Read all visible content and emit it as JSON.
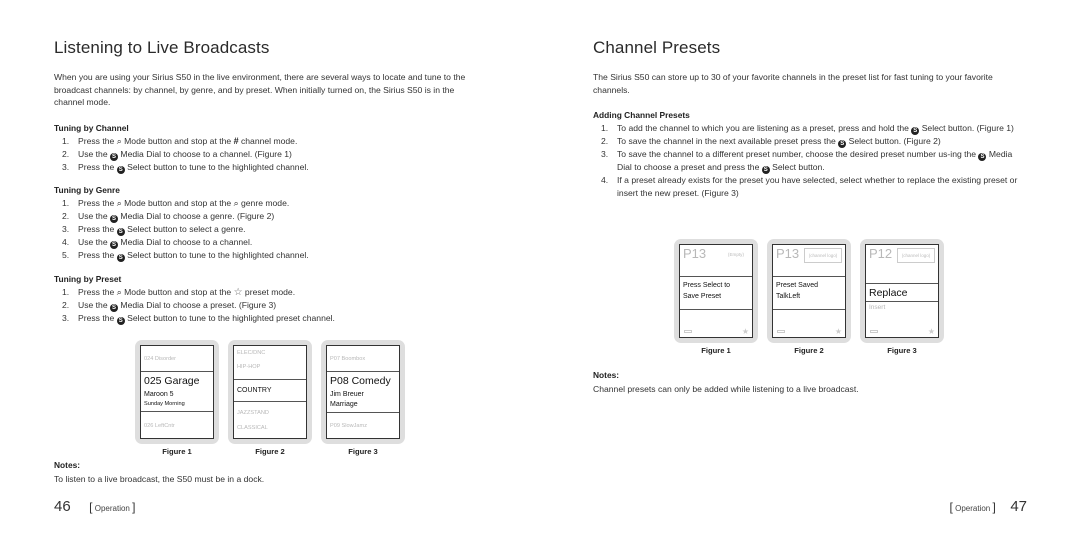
{
  "left_page": {
    "title": "Listening to Live Broadcasts",
    "intro": "When you are using your Sirius S50 in the live environment, there are several ways to locate and tune to the broadcast channels: by channel, by genre, and by preset. When initially turned on, the Sirius S50 is in the channel mode.",
    "sections": [
      {
        "heading": "Tuning by Channel",
        "steps": [
          {
            "num": "1.",
            "pre": "Press the",
            "icon1": "search-icon",
            "mid": "Mode button and stop at the",
            "icon2": "hash-icon",
            "post": "channel mode."
          },
          {
            "num": "2.",
            "pre": "Use the",
            "icon1": "media-dial-icon",
            "post": "Media Dial to choose to a channel. (Figure 1)"
          },
          {
            "num": "3.",
            "pre": "Press the",
            "icon1": "select-button-icon",
            "post": "Select button to tune to the highlighted channel."
          }
        ]
      },
      {
        "heading": "Tuning by Genre",
        "steps": [
          {
            "num": "1.",
            "pre": "Press the",
            "icon1": "search-icon",
            "mid": "Mode button and stop at the",
            "icon2": "search-icon",
            "post": "genre mode."
          },
          {
            "num": "2.",
            "pre": "Use the",
            "icon1": "media-dial-icon",
            "post": "Media Dial to choose a genre. (Figure 2)"
          },
          {
            "num": "3.",
            "pre": "Press the",
            "icon1": "select-button-icon",
            "post": "Select button to select a genre."
          },
          {
            "num": "4.",
            "pre": "Use the",
            "icon1": "media-dial-icon",
            "post": "Media Dial to choose to a channel."
          },
          {
            "num": "5.",
            "pre": "Press the",
            "icon1": "select-button-icon",
            "post": "Select button to tune to the highlighted channel."
          }
        ]
      },
      {
        "heading": "Tuning by Preset",
        "steps": [
          {
            "num": "1.",
            "pre": "Press the",
            "icon1": "search-icon",
            "mid": "Mode button and stop at the",
            "icon2": "star-outline-icon",
            "post": "preset mode."
          },
          {
            "num": "2.",
            "pre": "Use the",
            "icon1": "media-dial-icon",
            "post": "Media Dial to choose a preset. (Figure 3)"
          },
          {
            "num": "3.",
            "pre": "Press the",
            "icon1": "select-button-icon",
            "post": "Select button to tune to the highlighted preset channel."
          }
        ]
      }
    ],
    "figures": [
      {
        "caption": "Figure 1",
        "top": "024  Disorder",
        "main": "025 Garage",
        "line2": "Maroon 5",
        "line3": "Sunday Morning",
        "bottom": "026  LeftCntr"
      },
      {
        "caption": "Figure 2",
        "items_above": [
          "ELEC/DNC",
          "HIP-HOP"
        ],
        "main": "COUNTRY",
        "items_below": [
          "JAZZSTAND",
          "CLASSICAL"
        ]
      },
      {
        "caption": "Figure 3",
        "top": "P07  Boombox",
        "main": "P08 Comedy",
        "line2": "Jim Breuer",
        "line3": "Marriage",
        "bottom": "P09  SlowJamz"
      }
    ],
    "notes_heading": "Notes:",
    "notes_text": "To listen to a live broadcast, the S50 must be in a dock.",
    "footer": {
      "page_number": "46",
      "section": "Operation"
    }
  },
  "right_page": {
    "title": "Channel Presets",
    "intro": "The Sirius S50 can store up to 30 of your favorite channels in the preset list for fast tuning to your favorite channels.",
    "section_heading": "Adding Channel Presets",
    "steps": [
      {
        "num": "1.",
        "pre": "To add the channel to which you are listening as a preset, press and hold the",
        "icon1": "select-button-icon",
        "post": "Select button. (Figure 1)"
      },
      {
        "num": "2.",
        "pre": "To save the channel in the next available preset press the",
        "icon1": "select-button-icon",
        "post": "Select button. (Figure 2)"
      },
      {
        "num": "3.",
        "pre": "To save the channel to a different preset number, choose the desired preset number us-ing the",
        "icon1": "media-dial-icon",
        "mid": "Media Dial to choose a preset and press the",
        "icon2": "select-button-icon",
        "post": "Select button."
      },
      {
        "num": "4.",
        "pre": "If a preset already exists for the preset you have selected, select whether to replace the existing preset or insert the new preset. (Figure 3)"
      }
    ],
    "figures": [
      {
        "caption": "Figure 1",
        "preset": "P13",
        "tag": "(Empty)",
        "line1": "Press Select to",
        "line2": "Save Preset"
      },
      {
        "caption": "Figure 2",
        "preset": "P13",
        "tag": "(channel logo)",
        "line1": "Preset Saved",
        "line2": "TalkLeft"
      },
      {
        "caption": "Figure 3",
        "preset": "P12",
        "tag": "(channel logo)",
        "main": "Replace",
        "option": "Insert"
      }
    ],
    "notes_heading": "Notes:",
    "notes_text": "Channel presets can only be added while listening to a live broadcast.",
    "footer": {
      "page_number": "47",
      "section": "Operation"
    }
  }
}
